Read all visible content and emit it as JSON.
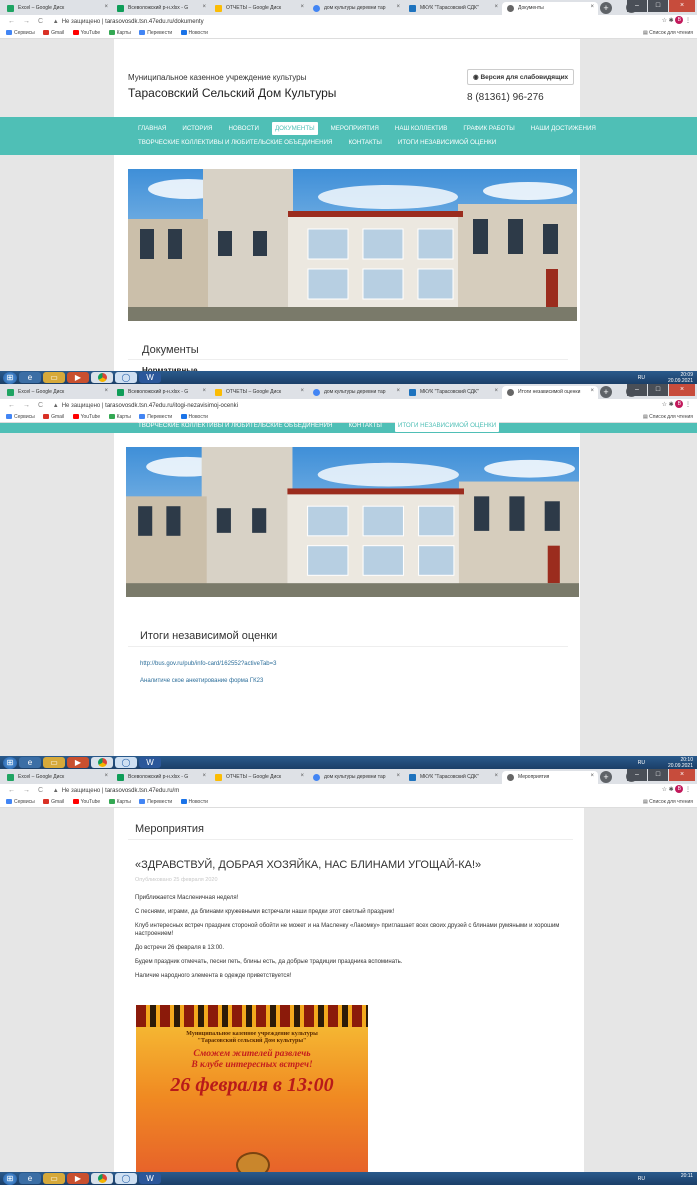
{
  "browser": {
    "shot1": {
      "tabs": [
        "Excel – Google Диск",
        "Всеволожский р-н.xlsx - G",
        "ОТЧЕТЫ – Google Диск",
        "дом культуры деревни тар",
        "МКУК \"Тарасовский СДК\"",
        "Документы"
      ],
      "url": "tarasovosdk.tsn.47edu.ru/dokumenty"
    },
    "shot2": {
      "tabs": [
        "Excel – Google Диск",
        "Всеволожский р-н.xlsx - G",
        "ОТЧЕТЫ – Google Диск",
        "дом культуры деревни тар",
        "МКУК \"Тарасовский СДК\"",
        "Итоги независимой оценки"
      ],
      "url": "tarasovosdk.tsn.47edu.ru/itogi-nezavisimoj-ocenki"
    },
    "shot3": {
      "tabs": [
        "Excel – Google Диск",
        "Всеволожский р-н.xlsx - G",
        "ОТЧЕТЫ – Google Диск",
        "дом культуры деревни тар",
        "МКУК \"Тарасовский СДК\"",
        "Мероприятия"
      ],
      "url": "tarasovosdk.tsn.47edu.ru/m"
    },
    "not_secure": "Не защищено",
    "bookmarks": [
      "Сервисы",
      "Gmail",
      "YouTube",
      "Карты",
      "Перевести",
      "Новости"
    ],
    "reading_list": "Список для чтения",
    "avatar_letter": "В"
  },
  "site": {
    "org_type": "Муниципальное казенное учреждение культуры",
    "org_name": "Тарасовский Сельский Дом Культуры",
    "vision_button": "Версия для слабовидящих",
    "phone": "8 (81361) 96-276",
    "nav_row1": [
      "ГЛАВНАЯ",
      "ИСТОРИЯ",
      "НОВОСТИ",
      "ДОКУМЕНТЫ",
      "МЕРОПРИЯТИЯ",
      "НАШ КОЛЛЕКТИВ",
      "ГРАФИК РАБОТЫ",
      "НАШИ ДОСТИЖЕНИЯ"
    ],
    "nav_row2": [
      "ТВОРЧЕСКИЕ КОЛЛЕКТИВЫ И ЛЮБИТЕЛЬСКИЕ ОБЪЕДИНЕНИЯ",
      "КОНТАКТЫ",
      "ИТОГИ НЕЗАВИСИМОЙ ОЦЕНКИ"
    ]
  },
  "page1": {
    "heading": "Документы",
    "subheading": "Нормативные"
  },
  "page2": {
    "heading": "Итоги независимой оценки",
    "link1": "http://bus.gov.ru/pub/info-card/162552?activeTab=3",
    "link2": "Аналитиче ское анкетирование форма ГК23"
  },
  "page3": {
    "heading": "Мероприятия",
    "article_title": "«ЗДРАВСТВУЙ, ДОБРАЯ ХОЗЯЙКА, НАС БЛИНАМИ УГОЩАЙ-КА!»",
    "published": "Опубликовано 25 февраля 2020",
    "paragraphs": [
      "Приближается Масленичная неделя!",
      "С песнями, играми, да блинами кружевными встречали наши предки этот светлый праздник!",
      "Клуб интересных встреч праздник стороной обойти не может и на Масленку «Лакомку» приглашает всех своих друзей с блинами румяными и хорошим настроением!",
      "До встречи 26 февраля в 13:00.",
      "Будем праздник отмечать, песни петь, блины есть, да добрые традиции праздника вспоминать.",
      "Наличие народного элемента в одежде приветствуется!"
    ],
    "poster": {
      "org_line1": "Муниципальное казенное учреждение культуры",
      "org_line2": "\"Тарасовский сельский Дом культуры\"",
      "slogan_line1": "Сможем жителей развлечь",
      "slogan_line2": "В клубе интересных встреч!",
      "date": "26 февраля в 13:00"
    }
  },
  "taskbar": {
    "lang": "RU",
    "shot1_time": "20:09",
    "shot1_date": "20.09.2021",
    "shot2_time": "20:10",
    "shot2_date": "20.09.2021",
    "shot3_time": "20:11"
  }
}
